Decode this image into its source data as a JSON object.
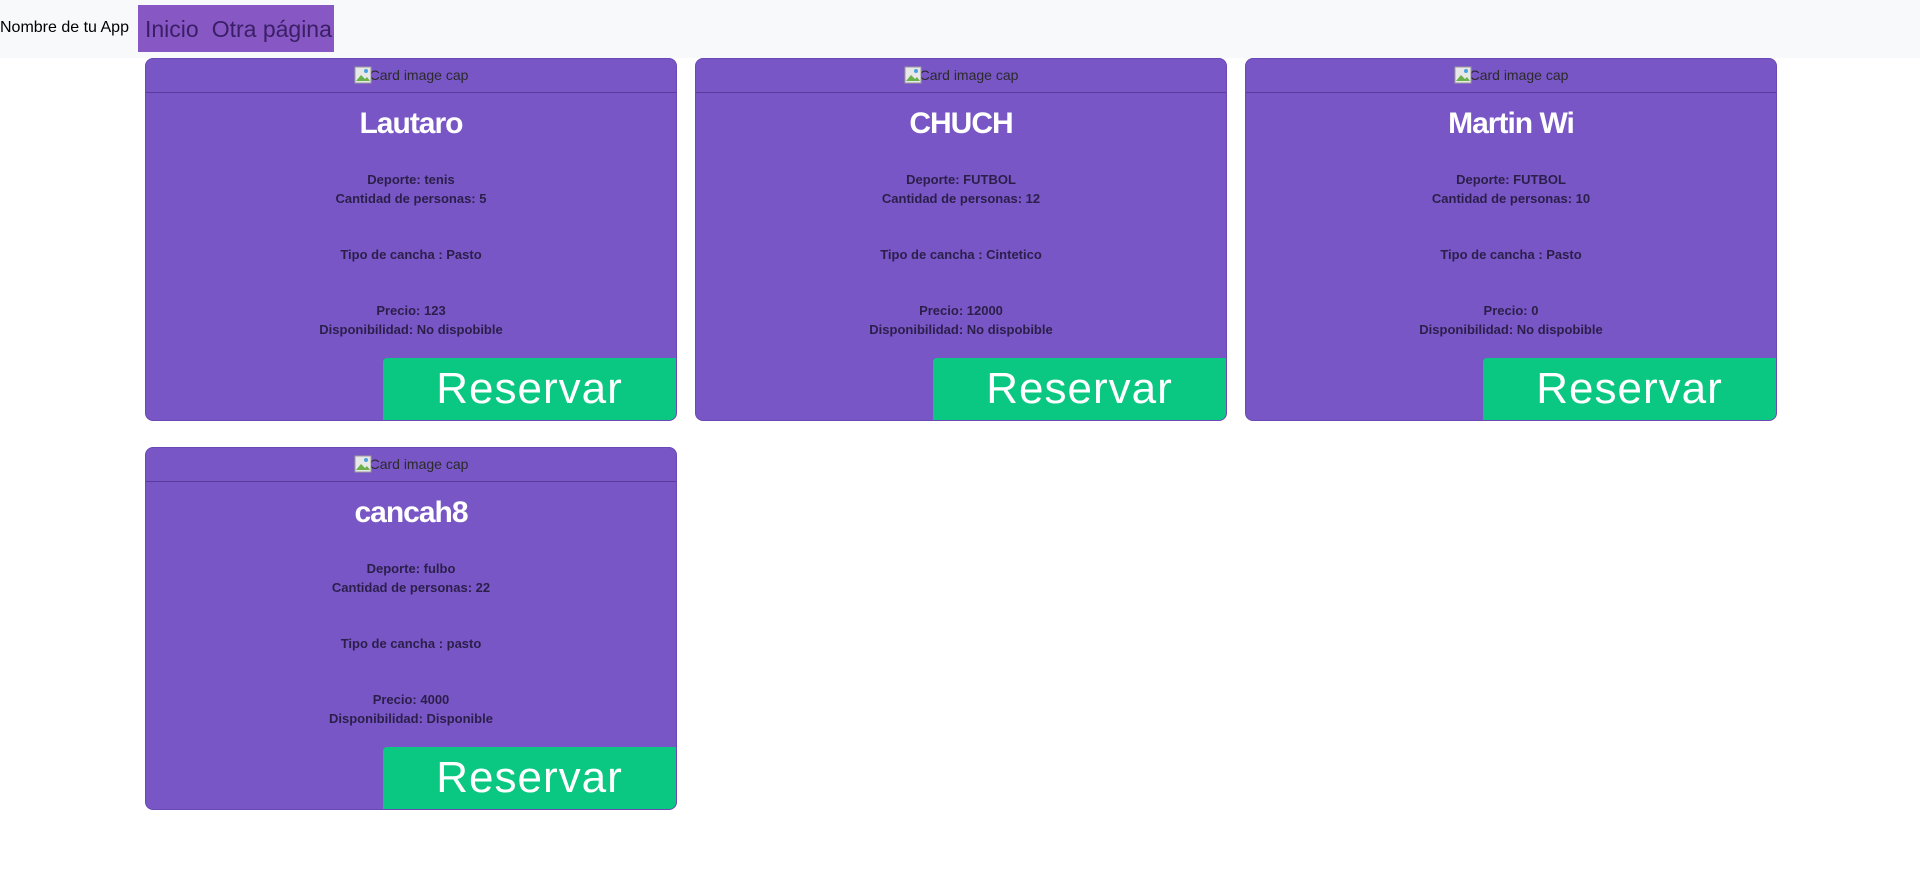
{
  "navbar": {
    "brand": "Nombre de tu App",
    "links": [
      "Inicio",
      "Otra página"
    ]
  },
  "colors": {
    "navbar_bg": "#f8f9fa",
    "nav_links_bg": "#8757c3",
    "card_bg": "#7956c6",
    "button_bg": "#0ac882",
    "title_text": "#ffffff"
  },
  "image_alt": "Card image cap",
  "labels": {
    "sport": "Deporte: ",
    "people": "Cantidad de personas: ",
    "court_type": "Tipo de cancha : ",
    "price": "Precio: ",
    "availability": "Disponibilidad: ",
    "reserve": "Reservar"
  },
  "cards": [
    {
      "title": "Lautaro",
      "sport": "Deporte: tenis",
      "people": "Cantidad de personas: 5",
      "court_type": "Tipo de cancha : Pasto",
      "price": "Precio: 123",
      "availability": "Disponibilidad: No dispobible",
      "button": "Reservar"
    },
    {
      "title": "CHUCH",
      "sport": "Deporte: FUTBOL",
      "people": "Cantidad de personas: 12",
      "court_type": "Tipo de cancha : Cintetico",
      "price": "Precio: 12000",
      "availability": "Disponibilidad: No dispobible",
      "button": "Reservar"
    },
    {
      "title": "Martin Wi",
      "sport": "Deporte: FUTBOL",
      "people": "Cantidad de personas: 10",
      "court_type": "Tipo de cancha : Pasto",
      "price": "Precio: 0",
      "availability": "Disponibilidad: No dispobible",
      "button": "Reservar"
    },
    {
      "title": "cancah8",
      "sport": "Deporte: fulbo",
      "people": "Cantidad de personas: 22",
      "court_type": "Tipo de cancha : pasto",
      "price": "Precio: 4000",
      "availability": "Disponibilidad: Disponible",
      "button": "Reservar"
    }
  ]
}
